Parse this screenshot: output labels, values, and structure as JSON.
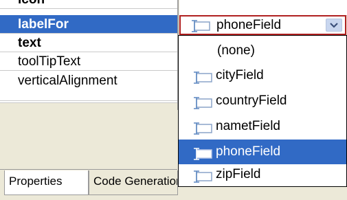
{
  "properties": {
    "rows": [
      {
        "name": "icon"
      },
      {
        "name": "labelFor"
      },
      {
        "name": "text"
      },
      {
        "name": "toolTipText"
      },
      {
        "name": "verticalAlignment"
      }
    ]
  },
  "combo": {
    "value": "phoneField",
    "icon": "text-field-icon",
    "button_icon": "chevron-down-icon"
  },
  "dropdown": {
    "options": [
      {
        "label": "(none)",
        "icon": ""
      },
      {
        "label": "cityField",
        "icon": "text-field-icon"
      },
      {
        "label": "countryField",
        "icon": "text-field-icon"
      },
      {
        "label": "nametField",
        "icon": "text-field-icon"
      },
      {
        "label": "phoneField",
        "icon": "text-field-icon"
      },
      {
        "label": "zipField",
        "icon": "text-field-icon"
      }
    ],
    "selected": "phoneField"
  },
  "tabs": [
    {
      "label": "Properties"
    },
    {
      "label": "Code Generation"
    }
  ],
  "colors": {
    "selection": "#316ac5",
    "combo_border": "#b02020",
    "panel_bg": "#ece9d8"
  }
}
